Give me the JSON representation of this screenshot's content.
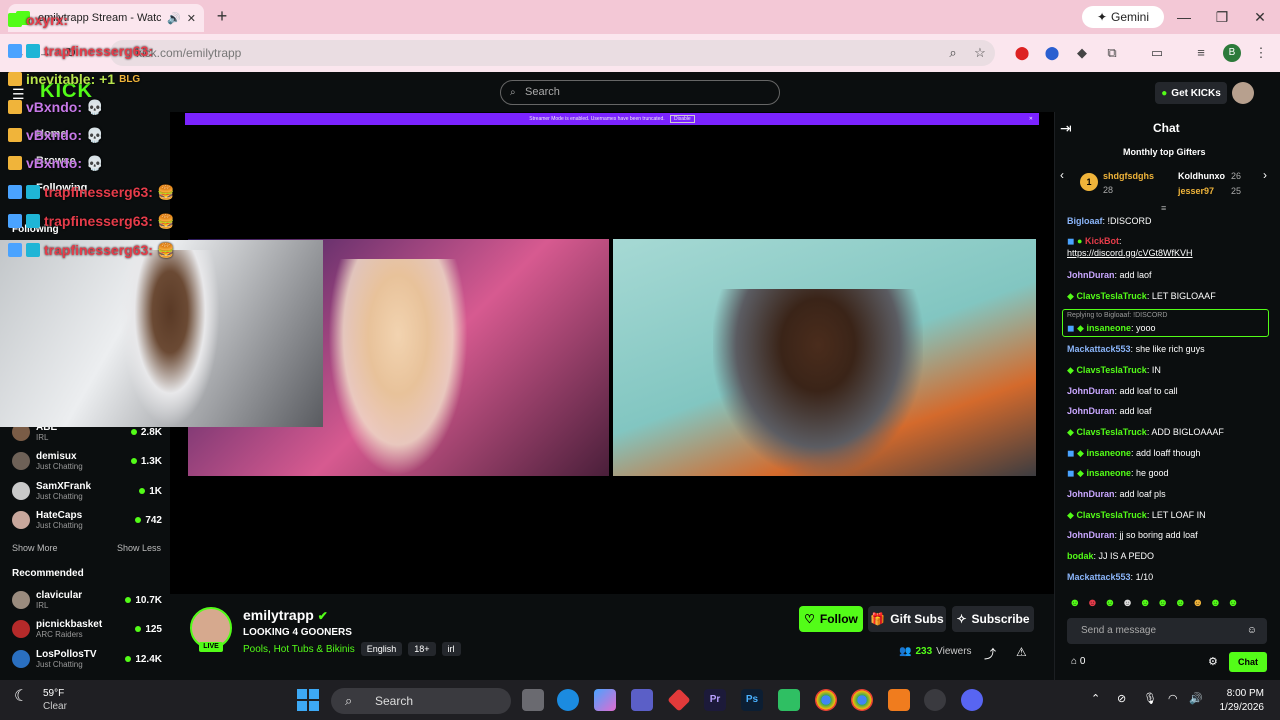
{
  "browser": {
    "tab_title": "emilytrapp Stream - Watch",
    "gemini_label": "Gemini",
    "address_text": "kick.com/emilytrapp",
    "profile_letter": "B"
  },
  "kick": {
    "logo": "KICK",
    "search_placeholder": "Search",
    "get_kicks_label": "Get KICKs"
  },
  "sidebar": {
    "nav": [
      "Home",
      "Browse",
      "Following"
    ],
    "following_title": "Following",
    "following": [
      {
        "name": "ABE",
        "sub": "IRL",
        "viewers": "2.8K"
      },
      {
        "name": "demisux",
        "sub": "Just Chatting",
        "viewers": "1.3K"
      },
      {
        "name": "SamXFrank",
        "sub": "Just Chatting",
        "viewers": "1K"
      },
      {
        "name": "HateCaps",
        "sub": "Just Chatting",
        "viewers": "742"
      }
    ],
    "show_more": "Show More",
    "show_less": "Show Less",
    "recommended_title": "Recommended",
    "recommended": [
      {
        "name": "clavicular",
        "sub": "IRL",
        "viewers": "10.7K"
      },
      {
        "name": "picnickbasket",
        "sub": "ARC Raiders",
        "viewers": "125"
      },
      {
        "name": "LosPollosTV",
        "sub": "Just Chatting",
        "viewers": "12.4K"
      }
    ]
  },
  "overlay_chat": [
    {
      "user": "oxyrx:",
      "color": "#e63c4a"
    },
    {
      "user": "trapfinesserg63:",
      "color": "#e63c4a"
    },
    {
      "user": "inevitable: +1",
      "color": "#b7e34d",
      "extra": "BLG"
    },
    {
      "user": "vBxndo:",
      "color": "#c779e8"
    },
    {
      "user": "vBxndo:",
      "color": "#c779e8"
    },
    {
      "user": "vBxndo:",
      "color": "#c779e8"
    },
    {
      "user": "trapfinesserg63:",
      "color": "#e63c4a"
    },
    {
      "user": "trapfinesserg63:",
      "color": "#e63c4a"
    },
    {
      "user": "trapfinesserg63:",
      "color": "#e63c4a"
    }
  ],
  "player": {
    "banner": "Streamer Mode is enabled. Usernames have been truncated.",
    "banner_button": "Disable"
  },
  "stream": {
    "channel": "emilytrapp",
    "title": "LOOKING 4 GOONERS",
    "category": "Pools, Hot Tubs & Bikinis",
    "tags": [
      "English",
      "18+",
      "irl"
    ],
    "live_label": "LIVE",
    "viewers": "233",
    "viewers_label": "Viewers",
    "follow_label": "Follow",
    "gift_label": "Gift Subs",
    "subscribe_label": "Subscribe"
  },
  "chat": {
    "title": "Chat",
    "gifters_title": "Monthly top Gifters",
    "gifters": [
      {
        "name": "shdgfsdghs",
        "count": "28"
      },
      {
        "name": "Koldhunxo",
        "count": "26"
      },
      {
        "name": "jesser97",
        "count": "25"
      }
    ],
    "messages": [
      {
        "user": "Bigloaaf",
        "text": "!DISCORD",
        "color": "#8ab4f8"
      },
      {
        "user": "KickBot",
        "text": "https://discord.gg/cVGt8WfKVH",
        "color": "#e63c4a"
      },
      {
        "user": "JohnDuran",
        "text": "add laof",
        "color": "#c9a7ff"
      },
      {
        "user": "ClavsTeslaTruck",
        "text": "LET BIGLOAAF",
        "color": "#53fc18"
      },
      {
        "user": "insaneone",
        "text": "yooo",
        "color": "#53fc18",
        "reply": "Replying to Bigloaaf: !DISCORD"
      },
      {
        "user": "Mackattack553",
        "text": "she like rich guys",
        "color": "#8ab4f8"
      },
      {
        "user": "ClavsTeslaTruck",
        "text": "IN",
        "color": "#53fc18"
      },
      {
        "user": "JohnDuran",
        "text": "add loaf to call",
        "color": "#c9a7ff"
      },
      {
        "user": "JohnDuran",
        "text": "add loaf",
        "color": "#c9a7ff"
      },
      {
        "user": "ClavsTeslaTruck",
        "text": "ADD BIGLOAAAF",
        "color": "#53fc18"
      },
      {
        "user": "insaneone",
        "text": "add loaff though",
        "color": "#53fc18"
      },
      {
        "user": "insaneone",
        "text": "he good",
        "color": "#53fc18"
      },
      {
        "user": "JohnDuran",
        "text": "add loaf pls",
        "color": "#c9a7ff"
      },
      {
        "user": "ClavsTeslaTruck",
        "text": "LET LOAF IN",
        "color": "#53fc18"
      },
      {
        "user": "JohnDuran",
        "text": "jj so boring add loaf",
        "color": "#c9a7ff"
      },
      {
        "user": "bodak",
        "text": "JJ IS A PEDO",
        "color": "#53fc18"
      },
      {
        "user": "Mackattack553",
        "text": "1/10",
        "color": "#8ab4f8"
      }
    ],
    "input_placeholder": "Send a message",
    "points": "0",
    "send_label": "Chat"
  },
  "taskbar": {
    "weather_temp": "59°F",
    "weather_desc": "Clear",
    "search_label": "Search",
    "time": "8:00 PM",
    "date": "1/29/2026"
  }
}
